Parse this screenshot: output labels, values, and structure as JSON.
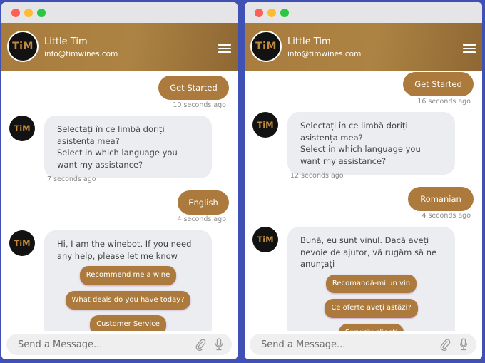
{
  "brand": {
    "accent": "#ab7a3c",
    "avatar_text": "TiM"
  },
  "windows": [
    {
      "header": {
        "name": "Little Tim",
        "email": "info@timwines.com"
      },
      "messages": {
        "get_started": {
          "text": "Get Started",
          "time": "10 seconds ago"
        },
        "language_prompt": {
          "line1": "Selectați în ce limbă doriți asistența mea?",
          "line2": "Select in which language you want my assistance?",
          "time": "7 seconds ago"
        },
        "language_choice": {
          "text": "English",
          "time": "4 seconds ago"
        },
        "greeting": {
          "text": "Hi, I am the winebot. If you need any help, please let me know"
        }
      },
      "quick_replies": [
        "Recommend me a wine",
        "What deals do you have today?",
        "Customer Service"
      ],
      "input": {
        "placeholder": "Send a Message..."
      }
    },
    {
      "header": {
        "name": "Little Tim",
        "email": "info@timwines.com"
      },
      "messages": {
        "get_started": {
          "text": "Get Started",
          "time": "16 seconds ago"
        },
        "language_prompt": {
          "line1": "Selectați în ce limbă doriți asistența mea?",
          "line2": "Select in which language you want my assistance?",
          "time": "12 seconds ago"
        },
        "language_choice": {
          "text": "Romanian",
          "time": "4 seconds ago"
        },
        "greeting": {
          "text": "Bună, eu sunt vinul. Dacă aveți nevoie de ajutor, vă rugăm să ne anunțați"
        }
      },
      "quick_replies": [
        "Recomandă-mi un vin",
        "Ce oferte aveți astăzi?",
        "Serviciu clienți"
      ],
      "input": {
        "placeholder": "Send a Message..."
      }
    }
  ]
}
